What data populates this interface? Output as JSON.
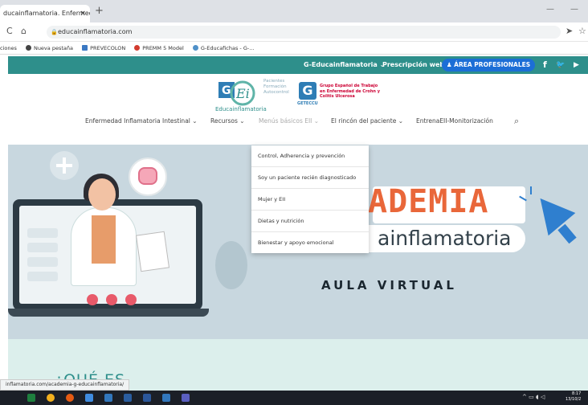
{
  "browser": {
    "tab_title": "ducainflamatoria. Enfermeda",
    "tab_close": "×",
    "new_tab": "+",
    "url": "educainflamatoria.com",
    "minimize": "—",
    "maximize": "—"
  },
  "bookmarks": [
    {
      "label": "ciones"
    },
    {
      "label": "Nueva pestaña",
      "color": "#444444"
    },
    {
      "label": "PREVECOLON",
      "color": "#3b78c3"
    },
    {
      "label": "PREMM 5 Model",
      "color": "#d23b2e"
    },
    {
      "label": "G-Educafichas - G-...",
      "color": "#4f90c8"
    }
  ],
  "topbar": {
    "menu_label": "G-Educainflamatoria ⌄",
    "prescripcion": "Prescripción web",
    "area_button": "♟ ÁREA PROFESIONALES",
    "facebook": "f",
    "twitter": "🐦",
    "youtube": "▶"
  },
  "logos": {
    "logo1_lines": "Pacientes\nFormación\nAutocontrol",
    "logo1_sub": "Educainflamatoria",
    "logo2_letter": "G",
    "logo2_lines": "Grupo Español de Trabajo\nen Enfermedad de Crohn y\nColitis Ulcerosa",
    "logo2_sub": "GETECCU"
  },
  "nav": [
    {
      "label": "Enfermedad Inflamatoria Intestinal ⌄"
    },
    {
      "label": "Recursos ⌄"
    },
    {
      "label": "Menús básicos EII ⌄"
    },
    {
      "label": "El rincón del paciente ⌄"
    },
    {
      "label": "EntrenaEII-Monitorización"
    }
  ],
  "dropdown": [
    {
      "label": "Control, Adherencia y prevención"
    },
    {
      "label": "Soy un paciente recién diagnosticado"
    },
    {
      "label": "Mujer y EII"
    },
    {
      "label": "Dietas y nutrición"
    },
    {
      "label": "Bienestar y apoyo emocional"
    }
  ],
  "hero": {
    "academia": "ADEMIA",
    "inflamatoria": "ainflamatoria",
    "aula": "AULA VIRTUAL"
  },
  "lower": {
    "que_es": "¿QUÉ ES"
  },
  "status_url": "inflamatoria.com/academia-g-educainflamatoria/",
  "clock": {
    "time": "8:17",
    "date": "13/10/2"
  },
  "colors": {
    "teal": "#2e8f8b",
    "blue": "#1c6ed6",
    "orange": "#e9673a"
  }
}
